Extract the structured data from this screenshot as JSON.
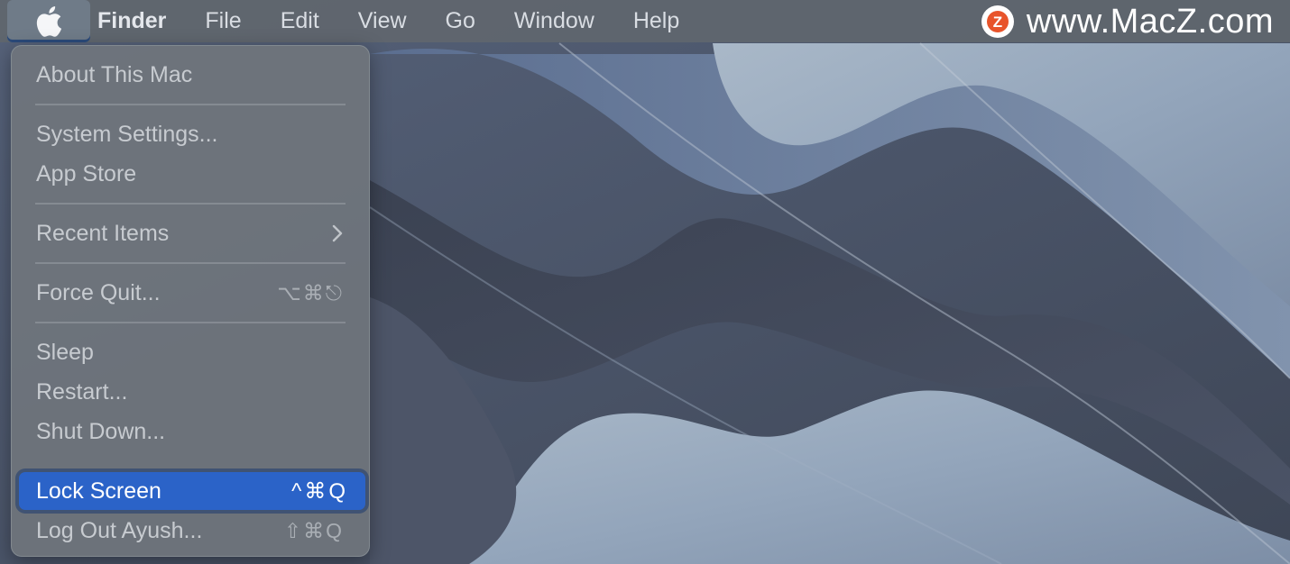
{
  "menubar": {
    "app_name": "Finder",
    "items": [
      "File",
      "Edit",
      "View",
      "Go",
      "Window",
      "Help"
    ]
  },
  "watermark": {
    "badge_letter": "Z",
    "text": "www.MacZ.com"
  },
  "apple_menu": {
    "about": "About This Mac",
    "system_settings": "System Settings...",
    "app_store": "App Store",
    "recent_items": "Recent Items",
    "force_quit": "Force Quit...",
    "force_quit_shortcut": "⌥⌘⎋",
    "sleep": "Sleep",
    "restart": "Restart...",
    "shut_down": "Shut Down...",
    "lock_screen": "Lock Screen",
    "lock_screen_shortcut": "^⌘Q",
    "log_out": "Log Out Ayush...",
    "log_out_shortcut": "⇧⌘Q"
  },
  "colors": {
    "highlight": "#2b63c8",
    "watermark_badge": "#e8542b"
  },
  "icons": {
    "apple": "apple-logo-icon",
    "submenu": "chevron-right-icon"
  }
}
